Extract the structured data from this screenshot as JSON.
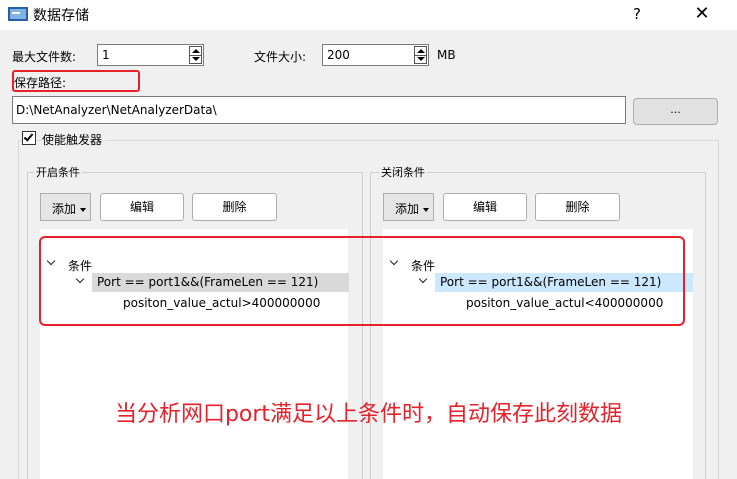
{
  "window": {
    "title": "数据存储",
    "help_label": "?",
    "close_label": "✕"
  },
  "file_settings": {
    "max_files_label": "最大文件数:",
    "max_files_value": "1",
    "file_size_label": "文件大小:",
    "file_size_value": "200",
    "file_size_unit": "MB"
  },
  "save_path": {
    "label": "保存路径:",
    "value": "D:\\NetAnalyzer\\NetAnalyzerData\\",
    "browse_label": "..."
  },
  "trigger": {
    "label": "使能触发器",
    "checked": true
  },
  "start_conditions": {
    "title": "开启条件",
    "add_label": "添加",
    "edit_label": "编辑",
    "delete_label": "删除",
    "tree": {
      "root": "条件",
      "node": "Port == port1&&(FrameLen == 121)",
      "leaf": "positon_value_actul>400000000"
    }
  },
  "stop_conditions": {
    "title": "关闭条件",
    "add_label": "添加",
    "edit_label": "编辑",
    "delete_label": "删除",
    "tree": {
      "root": "条件",
      "node": "Port == port1&&(FrameLen == 121)",
      "leaf": "positon_value_actul<400000000"
    }
  },
  "annotation": "当分析网口port满足以上条件时，自动保存此刻数据",
  "colors": {
    "highlight": "#e8202a",
    "selection": "#cce8ff",
    "selection_inactive": "#d9d9d9"
  }
}
